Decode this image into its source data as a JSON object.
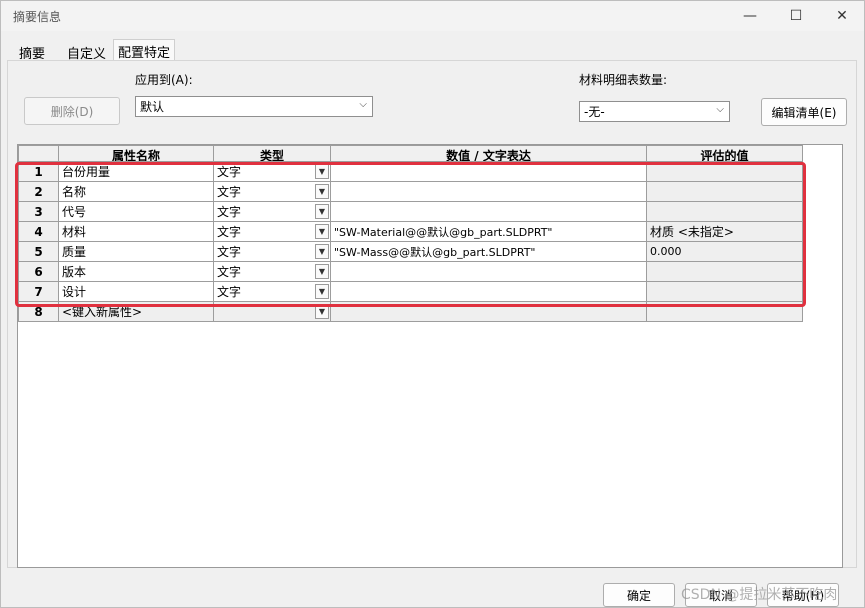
{
  "window": {
    "title": "摘要信息",
    "minimize": "—",
    "maximize": "☐",
    "close": "✕"
  },
  "tabs": [
    {
      "label": "摘要"
    },
    {
      "label": "自定义"
    },
    {
      "label": "配置特定"
    }
  ],
  "apply_to": {
    "label": "应用到(A):",
    "value": "默认"
  },
  "delete_button": "删除(D)",
  "bom_quantity": {
    "label": "材料明细表数量:",
    "value": "-无-"
  },
  "edit_list_button": "编辑清单(E)",
  "grid": {
    "headers": [
      "属性名称",
      "类型",
      "数值 / 文字表达",
      "评估的值"
    ],
    "rows": [
      {
        "num": "1",
        "name": "台份用量",
        "type": "文字",
        "expr": "",
        "evaluated": ""
      },
      {
        "num": "2",
        "name": "名称",
        "type": "文字",
        "expr": "",
        "evaluated": ""
      },
      {
        "num": "3",
        "name": "代号",
        "type": "文字",
        "expr": "",
        "evaluated": ""
      },
      {
        "num": "4",
        "name": "材料",
        "type": "文字",
        "expr": "\"SW-Material@@默认@gb_part.SLDPRT\"",
        "evaluated": "材质 <未指定>"
      },
      {
        "num": "5",
        "name": "质量",
        "type": "文字",
        "expr": "\"SW-Mass@@默认@gb_part.SLDPRT\"",
        "evaluated": "0.000"
      },
      {
        "num": "6",
        "name": "版本",
        "type": "文字",
        "expr": "",
        "evaluated": ""
      },
      {
        "num": "7",
        "name": "设计",
        "type": "文字",
        "expr": "",
        "evaluated": ""
      },
      {
        "num": "8",
        "name": "<键入新属性>",
        "type": "",
        "expr": "",
        "evaluated": ""
      }
    ]
  },
  "footer": {
    "ok": "确定",
    "cancel": "取消",
    "help": "帮助(H)"
  },
  "watermark": "CSDN @提拉米苏不吃肉",
  "colors": {
    "highlight": "#e0313f"
  }
}
